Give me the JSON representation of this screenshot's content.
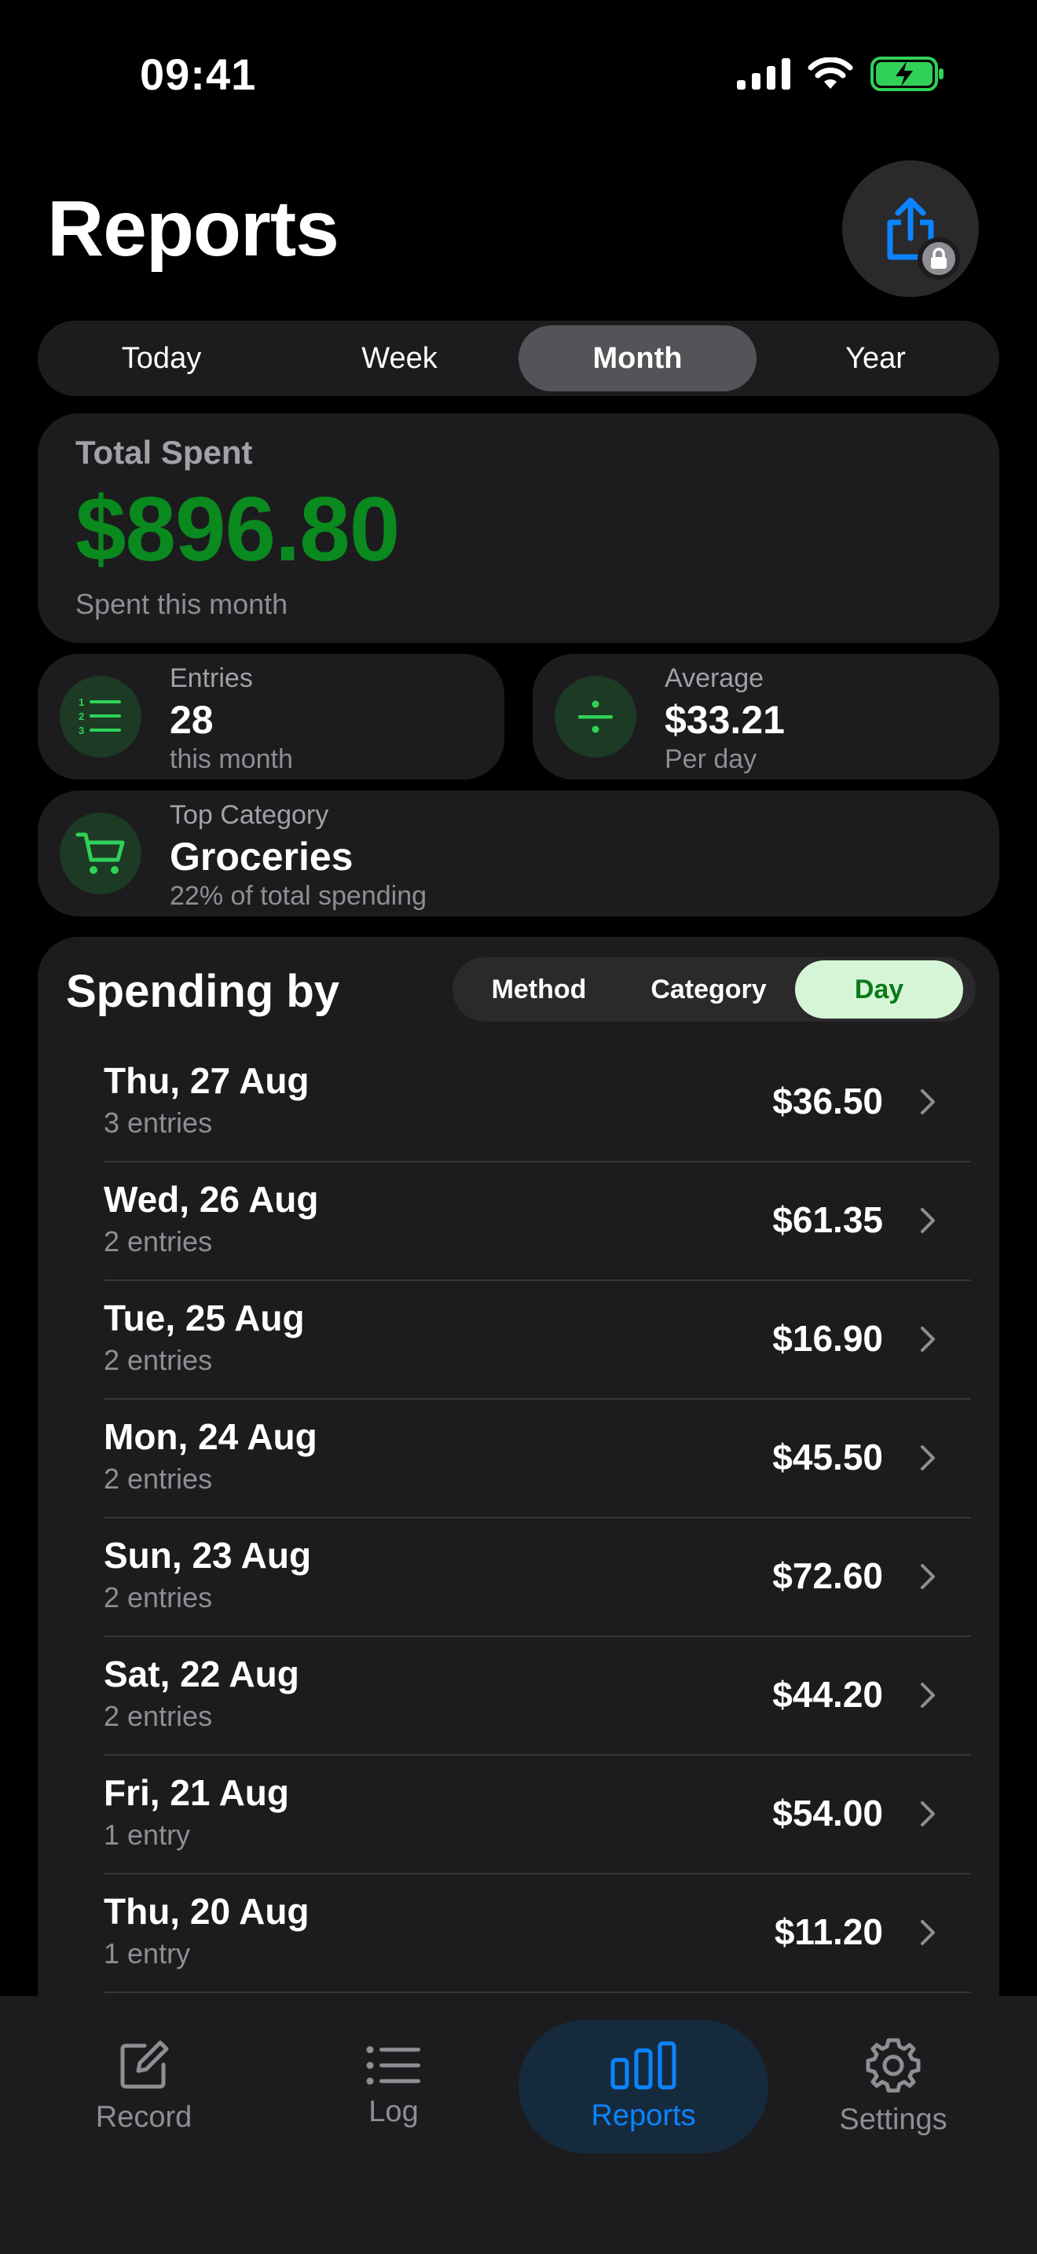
{
  "status": {
    "time": "09:41"
  },
  "header": {
    "title": "Reports"
  },
  "period_tabs": [
    {
      "label": "Today",
      "active": false
    },
    {
      "label": "Week",
      "active": false
    },
    {
      "label": "Month",
      "active": true
    },
    {
      "label": "Year",
      "active": false
    }
  ],
  "total": {
    "label": "Total Spent",
    "value": "$896.80",
    "sub": "Spent this month"
  },
  "stats": {
    "entries": {
      "label": "Entries",
      "value": "28",
      "sub": "this month"
    },
    "average": {
      "label": "Average",
      "value": "$33.21",
      "sub": "Per day"
    },
    "top_category": {
      "label": "Top Category",
      "value": "Groceries",
      "sub": "22% of total spending"
    }
  },
  "spending": {
    "title": "Spending by",
    "filters": [
      {
        "label": "Method",
        "active": false
      },
      {
        "label": "Category",
        "active": false
      },
      {
        "label": "Day",
        "active": true
      }
    ],
    "days": [
      {
        "date": "Thu, 27 Aug",
        "entries": "3 entries",
        "amount": "$36.50"
      },
      {
        "date": "Wed, 26 Aug",
        "entries": "2 entries",
        "amount": "$61.35"
      },
      {
        "date": "Tue, 25 Aug",
        "entries": "2 entries",
        "amount": "$16.90"
      },
      {
        "date": "Mon, 24 Aug",
        "entries": "2 entries",
        "amount": "$45.50"
      },
      {
        "date": "Sun, 23 Aug",
        "entries": "2 entries",
        "amount": "$72.60"
      },
      {
        "date": "Sat, 22 Aug",
        "entries": "2 entries",
        "amount": "$44.20"
      },
      {
        "date": "Fri, 21 Aug",
        "entries": "1 entry",
        "amount": "$54.00"
      },
      {
        "date": "Thu, 20 Aug",
        "entries": "1 entry",
        "amount": "$11.20"
      }
    ]
  },
  "tab_bar": [
    {
      "label": "Record",
      "icon": "compose-icon",
      "active": false
    },
    {
      "label": "Log",
      "icon": "list-icon",
      "active": false
    },
    {
      "label": "Reports",
      "icon": "bar-chart-icon",
      "active": true
    },
    {
      "label": "Settings",
      "icon": "gear-icon",
      "active": false
    }
  ],
  "colors": {
    "accent_green": "#0a8a1e",
    "accent_blue": "#0a84ff",
    "card_bg": "#1c1c1e"
  }
}
